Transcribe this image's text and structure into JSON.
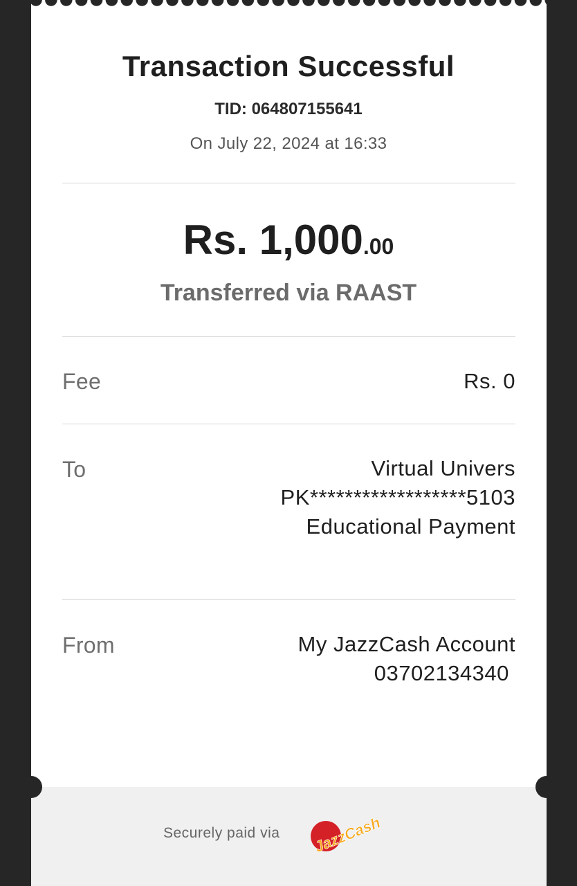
{
  "receipt": {
    "title": "Transaction Successful",
    "tid": "TID: 064807155641",
    "datetime": "On July 22, 2024 at 16:33",
    "amount_main": "Rs. 1,000",
    "amount_cents": ".00",
    "method": "Transferred via RAAST"
  },
  "details": {
    "fee_label": "Fee",
    "fee_value": "Rs. 0",
    "to_label": "To",
    "to_name": "Virtual Univers",
    "to_account": "PK******************5103",
    "to_purpose": "Educational Payment",
    "from_label": "From",
    "from_account_name": "My JazzCash Account",
    "from_number": "03702134340 "
  },
  "footer": {
    "secure_text": "Securely paid via",
    "logo_text": "JazzCash",
    "logo_colors": {
      "circle": "#d42027",
      "text": "#f7a81b"
    }
  }
}
